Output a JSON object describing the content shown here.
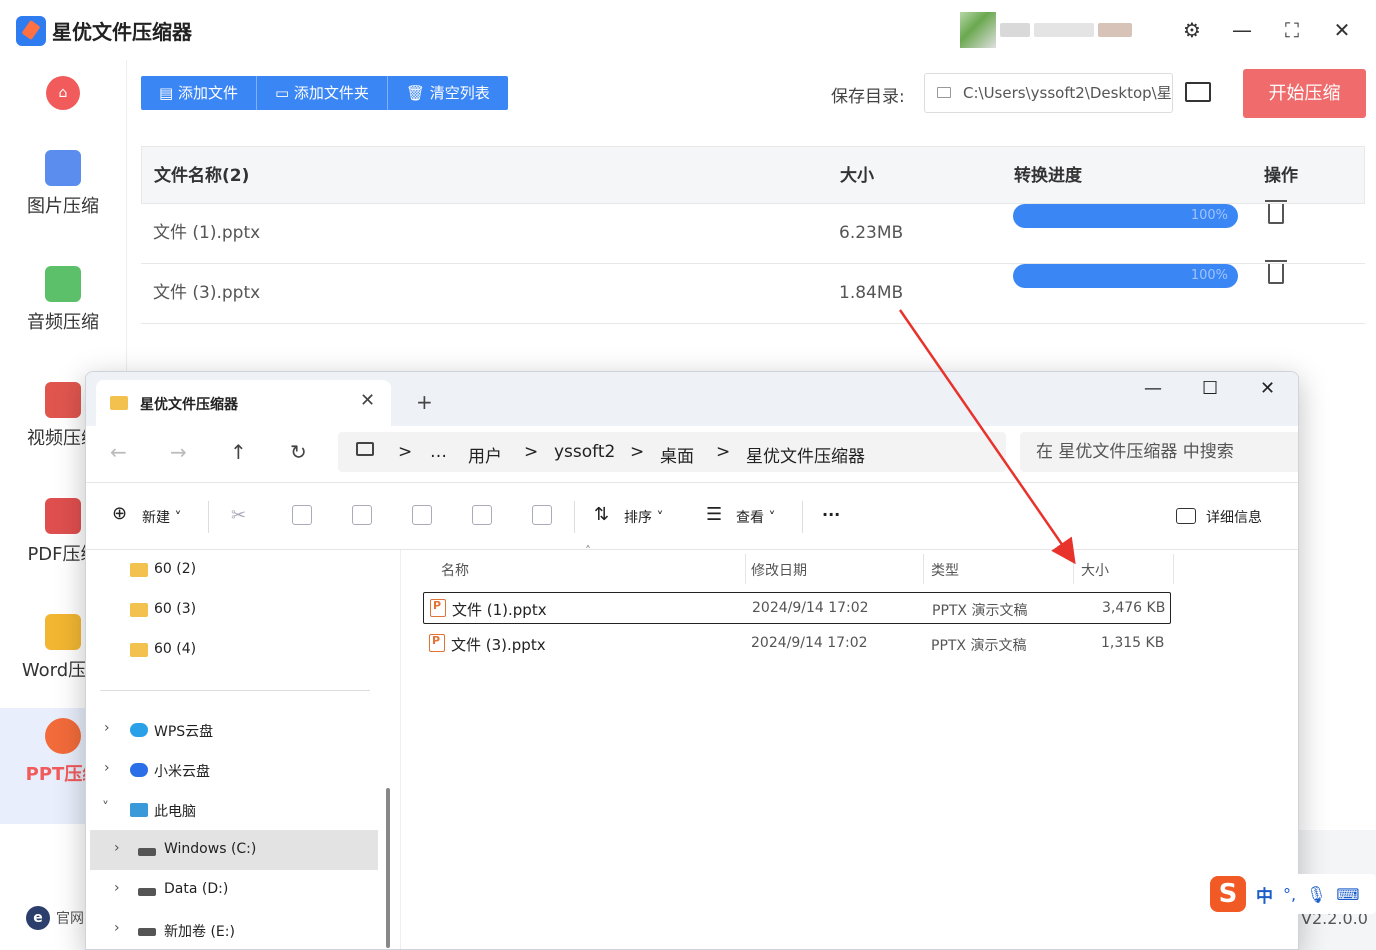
{
  "app": {
    "title": "星优文件压缩器",
    "window_controls": {
      "settings": "⚙",
      "minimize": "—",
      "maximize": "⛶",
      "close": "✕"
    },
    "sidebar": {
      "home_icon": "home-icon",
      "items": [
        {
          "label": "图片压缩",
          "icon": "image-icon",
          "color": "#5b8def"
        },
        {
          "label": "音频压缩",
          "icon": "music-icon",
          "color": "#5cbf6a"
        },
        {
          "label": "视频压缩",
          "icon": "video-icon",
          "color": "#e0564f"
        },
        {
          "label": "PDF压缩",
          "icon": "pdf-icon",
          "color": "#e04f4f"
        },
        {
          "label": "Word压缩",
          "icon": "word-icon",
          "color": "#f2b632"
        },
        {
          "label": "PPT压缩",
          "icon": "ppt-icon",
          "color": "#f26b3a"
        }
      ],
      "footer_label": "官网",
      "footer_icon_letter": "e"
    },
    "toolbar": {
      "add_file": "添加文件",
      "add_folder": "添加文件夹",
      "clear_list": "清空列表"
    },
    "save": {
      "label": "保存目录:",
      "path": "C:\\Users\\yssoft2\\Desktop\\星"
    },
    "start_button": "开始压缩",
    "table": {
      "headers": {
        "name": "文件名称(2)",
        "size": "大小",
        "progress": "转换进度",
        "action": "操作"
      },
      "rows": [
        {
          "name": "文件 (1).pptx",
          "size": "6.23MB",
          "progress": "100%"
        },
        {
          "name": "文件 (3).pptx",
          "size": "1.84MB",
          "progress": "100%"
        }
      ]
    },
    "version": "V2.2.0.0",
    "accent": "#3b86f5",
    "danger": "#f06b6b"
  },
  "explorer": {
    "tab_title": "星优文件压缩器",
    "tab_close": "✕",
    "new_tab": "+",
    "window_controls": {
      "minimize": "—",
      "maximize": "☐",
      "close": "✕"
    },
    "nav": {
      "back": "←",
      "forward": "→",
      "up": "↑",
      "refresh": "↻"
    },
    "breadcrumb": [
      "…",
      "用户",
      "yssoft2",
      "桌面",
      "星优文件压缩器"
    ],
    "breadcrumb_sep": ">",
    "search_placeholder": "在 星优文件压缩器 中搜索",
    "commands": {
      "new": "新建",
      "sort": "排序",
      "view": "查看",
      "more": "···",
      "details": "详细信息"
    },
    "tree": [
      {
        "label": "60 (2)",
        "icon": "folder-icon"
      },
      {
        "label": "60 (3)",
        "icon": "folder-icon"
      },
      {
        "label": "60 (4)",
        "icon": "folder-icon"
      },
      {
        "label": "WPS云盘",
        "icon": "cloud-icon"
      },
      {
        "label": "小米云盘",
        "icon": "cloud-icon"
      },
      {
        "label": "此电脑",
        "icon": "computer-icon"
      },
      {
        "label": "Windows (C:)",
        "icon": "drive-icon"
      },
      {
        "label": "Data (D:)",
        "icon": "drive-icon"
      },
      {
        "label": "新加卷 (E:)",
        "icon": "drive-icon"
      }
    ],
    "list": {
      "headers": {
        "name": "名称",
        "modified": "修改日期",
        "type": "类型",
        "size": "大小"
      },
      "rows": [
        {
          "name": "文件 (1).pptx",
          "modified": "2024/9/14 17:02",
          "type": "PPTX 演示文稿",
          "size": "3,476 KB"
        },
        {
          "name": "文件 (3).pptx",
          "modified": "2024/9/14 17:02",
          "type": "PPTX 演示文稿",
          "size": "1,315 KB"
        }
      ]
    }
  },
  "ime": {
    "logo": "S",
    "mode": "中",
    "punct": "°,",
    "mic_icon": "mic-icon",
    "keyboard_icon": "keyboard-icon"
  }
}
